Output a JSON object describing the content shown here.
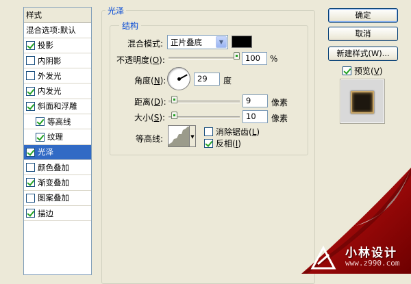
{
  "style_list": {
    "header": "样式",
    "items": [
      {
        "label": "混合选项:默认",
        "checkbox": false,
        "checked": false,
        "indent": false,
        "selected": false
      },
      {
        "label": "投影",
        "checkbox": true,
        "checked": true,
        "indent": false,
        "selected": false
      },
      {
        "label": "内阴影",
        "checkbox": true,
        "checked": false,
        "indent": false,
        "selected": false
      },
      {
        "label": "外发光",
        "checkbox": true,
        "checked": false,
        "indent": false,
        "selected": false
      },
      {
        "label": "内发光",
        "checkbox": true,
        "checked": true,
        "indent": false,
        "selected": false
      },
      {
        "label": "斜面和浮雕",
        "checkbox": true,
        "checked": true,
        "indent": false,
        "selected": false
      },
      {
        "label": "等高线",
        "checkbox": true,
        "checked": true,
        "indent": true,
        "selected": false
      },
      {
        "label": "纹理",
        "checkbox": true,
        "checked": true,
        "indent": true,
        "selected": false
      },
      {
        "label": "光泽",
        "checkbox": true,
        "checked": true,
        "indent": false,
        "selected": true
      },
      {
        "label": "颜色叠加",
        "checkbox": true,
        "checked": false,
        "indent": false,
        "selected": false
      },
      {
        "label": "渐变叠加",
        "checkbox": true,
        "checked": true,
        "indent": false,
        "selected": false
      },
      {
        "label": "图案叠加",
        "checkbox": true,
        "checked": false,
        "indent": false,
        "selected": false
      },
      {
        "label": "描边",
        "checkbox": true,
        "checked": true,
        "indent": false,
        "selected": false
      }
    ]
  },
  "panel": {
    "title": "光泽",
    "structure_title": "结构",
    "blend_mode": {
      "label": "混合模式:",
      "value": "正片叠底",
      "color": "#000000"
    },
    "opacity": {
      "label_pre": "不透明度(",
      "key": "O",
      "label_post": "):",
      "value": "100",
      "unit": "%",
      "level": 1.0
    },
    "angle": {
      "label_pre": "角度(",
      "key": "N",
      "label_post": "):",
      "value": "29",
      "unit": "度"
    },
    "distance": {
      "label_pre": "距离(",
      "key": "D",
      "label_post": "):",
      "value": "9",
      "unit": "像素",
      "level": 0.04
    },
    "size": {
      "label_pre": "大小(",
      "key": "S",
      "label_post": "):",
      "value": "10",
      "unit": "像素",
      "level": 0.04
    },
    "contour": {
      "label": "等高线:"
    },
    "anti_alias": {
      "label_pre": "消除锯齿(",
      "key": "L",
      "label_post": ")",
      "checked": false
    },
    "invert": {
      "label_pre": "反相(",
      "key": "I",
      "label_post": ")",
      "checked": true
    }
  },
  "buttons": {
    "ok": "确定",
    "cancel": "取消",
    "new_style": "新建样式(W)...",
    "preview_pre": "预览(",
    "preview_key": "V",
    "preview_post": ")",
    "preview_checked": true
  },
  "watermark": {
    "name": "小林设计",
    "site": "www.z990.com"
  },
  "colors": {
    "selection": "#316ac5",
    "curl_red": "#a80000",
    "dialog_bg": "#ece9d8"
  }
}
